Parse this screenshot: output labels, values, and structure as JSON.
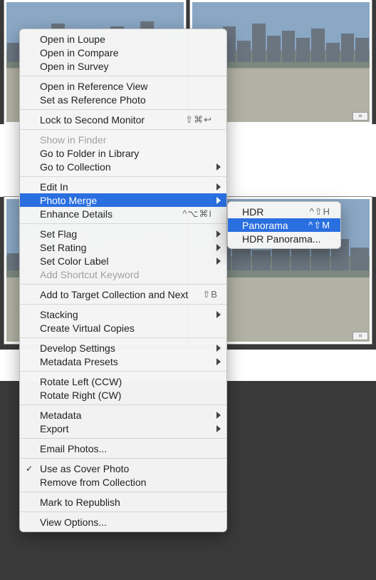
{
  "menu": {
    "open_loupe": "Open in Loupe",
    "open_compare": "Open in Compare",
    "open_survey": "Open in Survey",
    "open_reference": "Open in Reference View",
    "set_reference": "Set as Reference Photo",
    "lock_monitor": "Lock to Second Monitor",
    "lock_monitor_shortcut": "⇧⌘↩",
    "show_finder": "Show in Finder",
    "go_folder": "Go to Folder in Library",
    "go_collection": "Go to Collection",
    "edit_in": "Edit In",
    "photo_merge": "Photo Merge",
    "enhance_details": "Enhance Details",
    "enhance_details_shortcut": "^⌥⌘I",
    "set_flag": "Set Flag",
    "set_rating": "Set Rating",
    "set_color": "Set Color Label",
    "add_keyword": "Add Shortcut Keyword",
    "add_target": "Add to Target Collection and Next",
    "add_target_shortcut": "⇧B",
    "stacking": "Stacking",
    "virtual_copies": "Create Virtual Copies",
    "develop_settings": "Develop Settings",
    "metadata_presets": "Metadata Presets",
    "rotate_left": "Rotate Left (CCW)",
    "rotate_right": "Rotate Right (CW)",
    "metadata": "Metadata",
    "export": "Export",
    "email_photos": "Email Photos...",
    "use_cover": "Use as Cover Photo",
    "remove_collection": "Remove from Collection",
    "mark_republish": "Mark to Republish",
    "view_options": "View Options..."
  },
  "submenu": {
    "hdr": "HDR",
    "hdr_shortcut": "^⇧H",
    "panorama": "Panorama",
    "panorama_shortcut": "^⇧M",
    "hdr_panorama": "HDR Panorama..."
  }
}
